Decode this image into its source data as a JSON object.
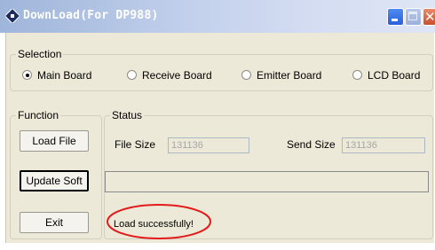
{
  "window": {
    "title": "DownLoad(For DP988)"
  },
  "selection": {
    "legend": "Selection",
    "options": [
      {
        "label": "Main Board",
        "checked": true
      },
      {
        "label": "Receive Board",
        "checked": false
      },
      {
        "label": "Emitter Board",
        "checked": false
      },
      {
        "label": "LCD Board",
        "checked": false
      }
    ]
  },
  "function": {
    "legend": "Function",
    "load_file": "Load File",
    "update_soft": "Update Soft",
    "exit": "Exit"
  },
  "status": {
    "legend": "Status",
    "file_size_label": "File Size",
    "file_size_value": "131136",
    "send_size_label": "Send Size",
    "send_size_value": "131136",
    "progress": 0,
    "message": "Load successfully!"
  },
  "colors": {
    "annotation": "#e31b1b",
    "title_text": "#ffffff"
  },
  "icons": [
    "app-icon",
    "minimize-icon",
    "maximize-icon",
    "close-icon"
  ]
}
